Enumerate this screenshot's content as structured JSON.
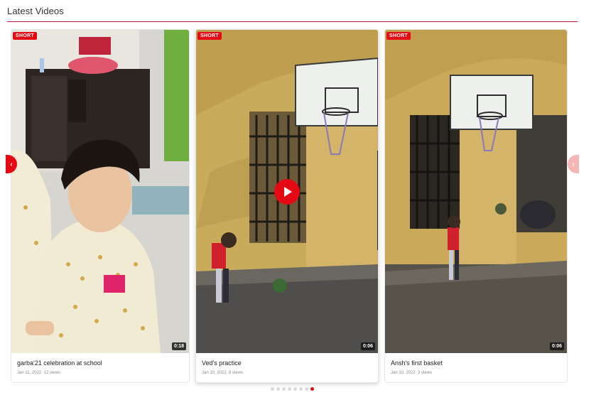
{
  "section": {
    "title": "Latest Videos"
  },
  "colors": {
    "accent": "#e50914",
    "rule": "#c8102e"
  },
  "nav": {
    "prev_icon": "chevron-left-icon",
    "prev_glyph": "‹",
    "next_icon": "chevron-right-icon",
    "next_glyph": "›"
  },
  "cards": [
    {
      "badge": "SHORT",
      "duration": "0:18",
      "title": "garba'21 celebration at school",
      "date": "Jan 11, 2022",
      "views": "12 views"
    },
    {
      "badge": "SHORT",
      "duration": "0:06",
      "title": "Ved's practice",
      "date": "Jan 10, 2022",
      "views": "8 views",
      "play_icon": "play-icon"
    },
    {
      "badge": "SHORT",
      "duration": "0:06",
      "title": "Ansh's first basket",
      "date": "Jan 10, 2022",
      "views": "3 views"
    }
  ],
  "pagination": {
    "count": 8,
    "active_index": 7
  }
}
